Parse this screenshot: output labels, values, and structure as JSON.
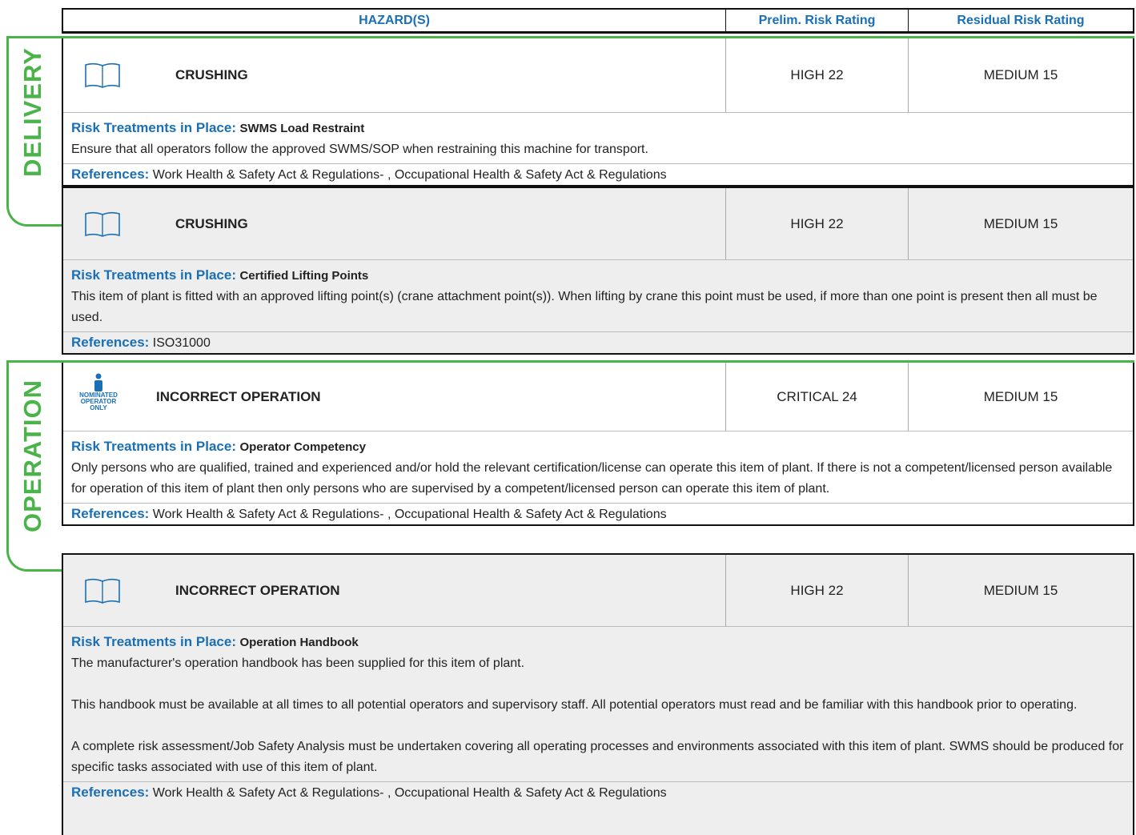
{
  "header": {
    "hazards": "HAZARD(S)",
    "prelim": "Prelim. Risk Rating",
    "residual": "Residual Risk Rating"
  },
  "sections": [
    {
      "label": "DELIVERY"
    },
    {
      "label": "OPERATION"
    }
  ],
  "rows": [
    {
      "icon": "handbook-icon",
      "hazard": "CRUSHING",
      "prelim": "HIGH 22",
      "residual": "MEDIUM 15",
      "rt_label": "Risk Treatments in Place:",
      "rt_name": "SWMS Load Restraint",
      "desc": [
        "Ensure that all operators follow the approved SWMS/SOP when restraining this machine for transport."
      ],
      "ref_label": "References:",
      "refs": "Work Health & Safety Act & Regulations- , Occupational Health & Safety Act & Regulations"
    },
    {
      "icon": "handbook-icon",
      "hazard": "CRUSHING",
      "prelim": "HIGH 22",
      "residual": "MEDIUM 15",
      "rt_label": "Risk Treatments in Place:",
      "rt_name": "Certified Lifting Points",
      "desc": [
        "This item of plant is fitted with an approved lifting point(s) (crane attachment point(s)). When lifting by crane this point must be used, if more than one point is present then all must be used."
      ],
      "ref_label": "References:",
      "refs": "ISO31000"
    },
    {
      "icon": "nominated-operator-icon",
      "icon_text": [
        "NOMINATED",
        "OPERATOR",
        "ONLY"
      ],
      "hazard": "INCORRECT OPERATION",
      "prelim": "CRITICAL 24",
      "residual": "MEDIUM 15",
      "rt_label": "Risk Treatments in Place:",
      "rt_name": "Operator Competency",
      "desc": [
        "Only persons who are qualified, trained and experienced and/or hold the relevant certification/license can operate this item of plant. If there is not a competent/licensed person available for operation of this item of plant then only persons who are supervised by a competent/licensed person can operate this item of plant."
      ],
      "ref_label": "References:",
      "refs": "Work Health & Safety Act & Regulations- , Occupational Health & Safety Act & Regulations"
    },
    {
      "icon": "handbook-icon",
      "hazard": "INCORRECT OPERATION",
      "prelim": "HIGH 22",
      "residual": "MEDIUM 15",
      "rt_label": "Risk Treatments in Place:",
      "rt_name": "Operation Handbook",
      "desc": [
        "The manufacturer's operation handbook has been supplied for this item of plant.",
        "This handbook must be available at all times to all potential operators and supervisory staff. All potential operators must read and be familiar with this handbook prior to operating.",
        "A complete risk assessment/Job Safety Analysis must be undertaken covering all operating processes and environments associated with this item of plant. SWMS should be produced for specific tasks associated with use of this item of plant."
      ],
      "ref_label": "References:",
      "refs": "Work Health & Safety Act & Regulations- , Occupational Health & Safety Act & Regulations"
    }
  ]
}
